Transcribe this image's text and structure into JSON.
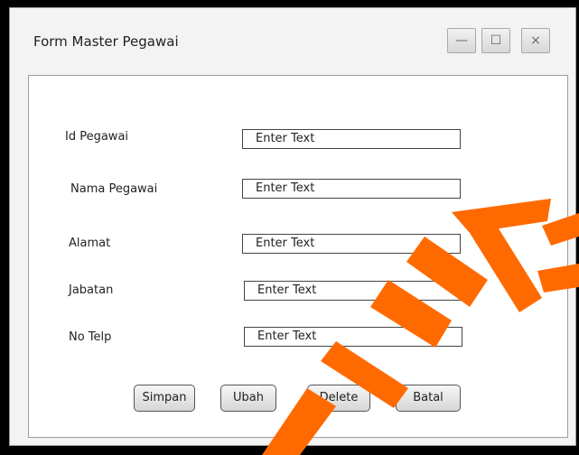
{
  "window": {
    "title": "Form Master Pegawai",
    "controls": {
      "minimize": "—",
      "maximize": "☐",
      "close": "×"
    }
  },
  "form": {
    "fields": [
      {
        "label": "Id Pegawai",
        "value": "Enter Text"
      },
      {
        "label": "Nama Pegawai",
        "value": "Enter Text"
      },
      {
        "label": "Alamat",
        "value": "Enter Text"
      },
      {
        "label": "Jabatan",
        "value": "Enter Text"
      },
      {
        "label": "No Telp",
        "value": "Enter Text"
      }
    ]
  },
  "buttons": {
    "simpan": "Simpan",
    "ubah": "Ubah",
    "delete": "Delete",
    "batal": "Batal"
  },
  "colors": {
    "watermark": "#ff6a00",
    "background": "#000000"
  }
}
